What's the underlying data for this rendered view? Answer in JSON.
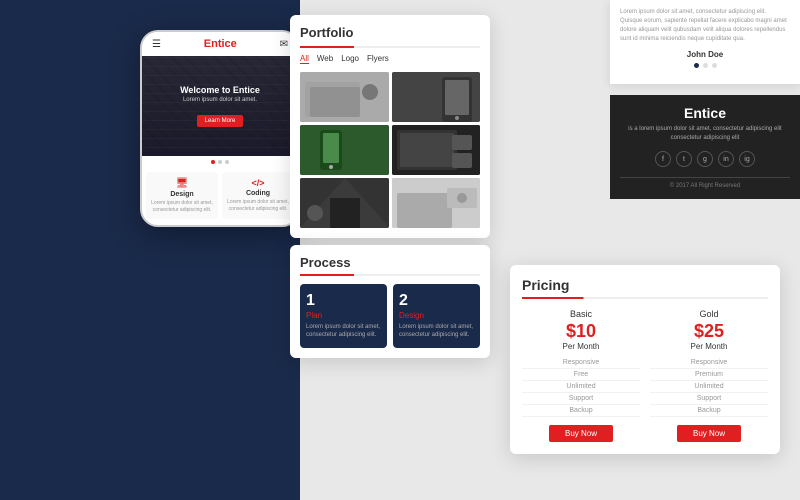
{
  "background": {
    "left_color": "#1a2a4a",
    "right_color": "#e8e8e8"
  },
  "mobile": {
    "brand": "Entice",
    "hero_title": "Welcome to Entice",
    "hero_sub": "Lorem ipsum dolor sit amet.",
    "hero_btn": "Learn More",
    "features": [
      {
        "icon": "🖥",
        "title": "Design",
        "text": "Lorem ipsum dolor sit amet, consectetur adipiscing elit."
      },
      {
        "icon": "</>",
        "title": "Coding",
        "text": "Lorem ipsum dolor sit amet, consectetur adipiscing elit."
      }
    ]
  },
  "portfolio": {
    "title": "Portfolio",
    "tabs": [
      "All",
      "Web",
      "Logo",
      "Flyers"
    ],
    "active_tab": "All"
  },
  "process": {
    "title": "Process",
    "steps": [
      {
        "number": "1",
        "name": "Plan",
        "text": "Lorem ipsum dolor sit amet, consectetur adipiscing elit."
      },
      {
        "number": "2",
        "name": "Design",
        "text": "Lorem ipsum dolor sit amet, consectetur adipiscing elit."
      }
    ]
  },
  "pricing": {
    "title": "Pricing",
    "plans": [
      {
        "name": "Basic",
        "amount": "$10",
        "period": "Per Month",
        "features": [
          "Responsive",
          "Free",
          "Unlimited",
          "Support",
          "Backup"
        ],
        "btn": "Buy Now"
      },
      {
        "name": "Gold",
        "amount": "$25",
        "period": "Per Month",
        "features": [
          "Responsive",
          "Premium",
          "Unlimited",
          "Support",
          "Backup"
        ],
        "btn": "Buy Now"
      }
    ]
  },
  "testimonial": {
    "text": "Lorem ipsum dolor sit amet, consectetur adipiscing elit. Quisque eorum, sapiente repellat facere explicabo magni amet dolore aliquam velit qubusdam velit aliqua dolores repellendus sunt id minima reiciendis neque cupiditate qua.",
    "name": "John Doe"
  },
  "footer": {
    "brand": "Entice",
    "description": "is a lorem ipsum dolor sit amet, consectetur adipiscing elit consectetur adipiscing elit",
    "socials": [
      "f",
      "t",
      "g",
      "in",
      "ig"
    ],
    "copyright": "© 2017 All Right Reserved"
  }
}
